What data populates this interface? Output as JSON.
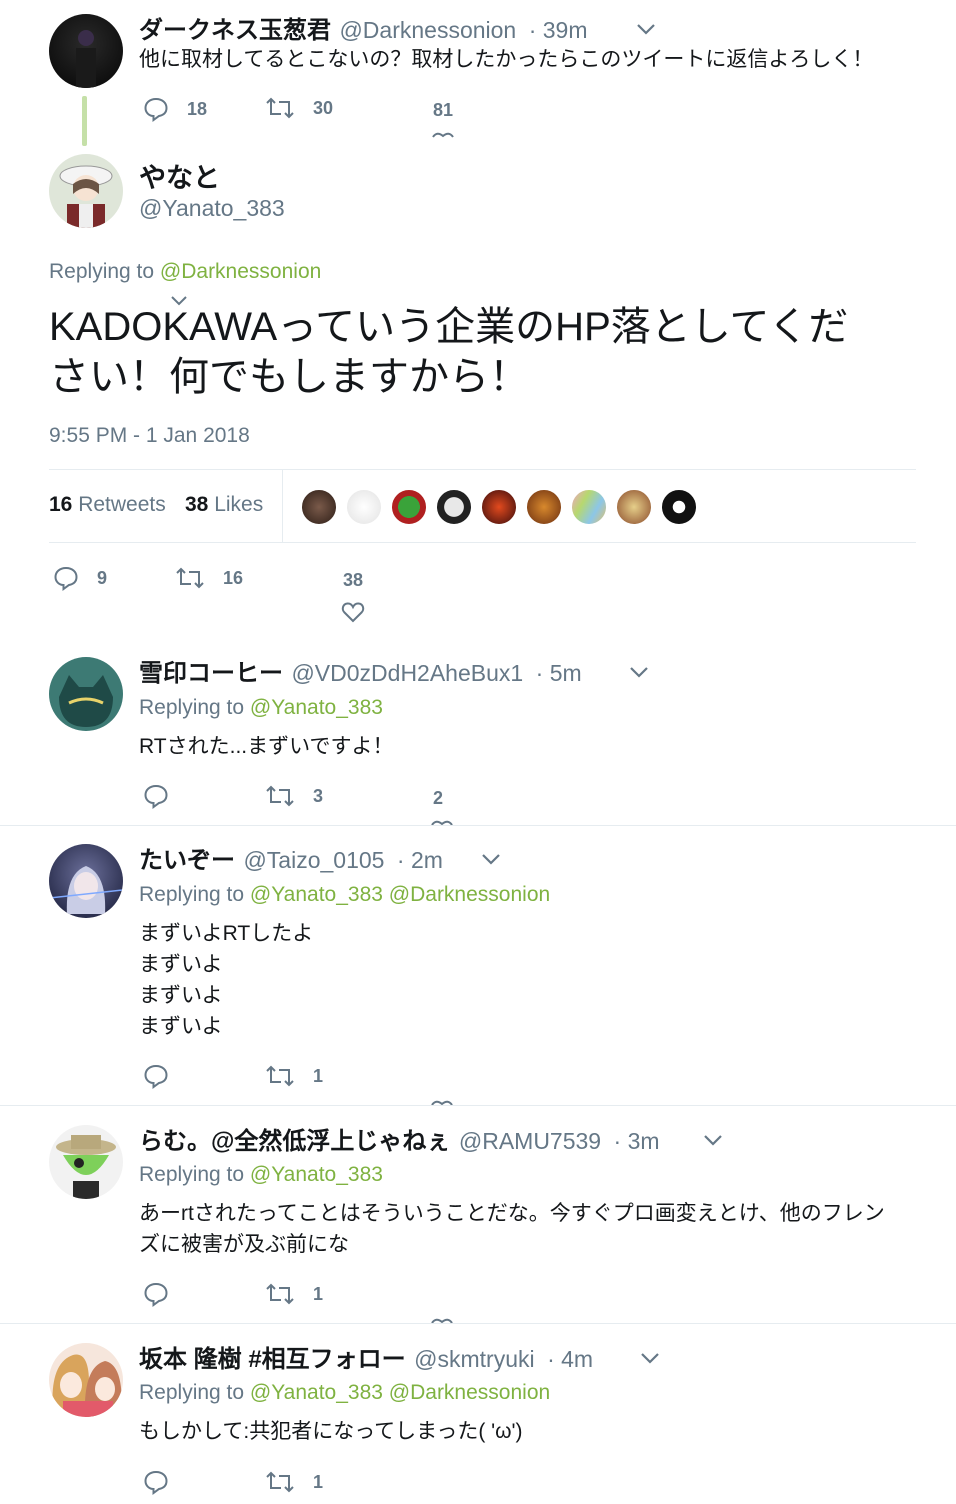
{
  "parent_tweet": {
    "name": "ダークネス玉葱君",
    "handle": "@Darknessonion",
    "time": "· 39m",
    "text": "他に取材してるとこないの？取材したかったらこのツイートに返信よろしく！",
    "replies": "18",
    "retweets": "30",
    "likes": "81"
  },
  "main_tweet": {
    "name": "やなと",
    "handle": "@Yanato_383",
    "replying_prefix": "Replying to",
    "replying_to": "@Darknessonion",
    "text_line1": "KADOKAWAっていう企業のHP落としてくだ",
    "text_line2": "さい！何でもしますから！",
    "timestamp": "9:55 PM - 1 Jan 2018",
    "retweet_count": "16",
    "retweet_label": "Retweets",
    "like_count": "38",
    "like_label": "Likes",
    "replies": "9",
    "retweets": "16",
    "likes": "38"
  },
  "replies": [
    {
      "name": "雪印コーヒー",
      "handle": "@VD0zDdH2AheBux1",
      "time": "· 5m",
      "replying_prefix": "Replying to",
      "replying_to": "@Yanato_383",
      "lines": [
        "RTされた...まずいですよ！"
      ],
      "retweets": "3",
      "likes": "2"
    },
    {
      "name": "たいぞー",
      "handle": "@Taizo_0105",
      "time": "· 2m",
      "replying_prefix": "Replying to",
      "replying_to": "@Yanato_383 @Darknessonion",
      "lines": [
        "まずいよRTしたよ",
        "まずいよ",
        "まずいよ",
        "まずいよ"
      ],
      "retweets": "1"
    },
    {
      "name": "らむ。@全然低浮上じゃねぇ",
      "handle": "@RAMU7539",
      "time": "· 3m",
      "replying_prefix": "Replying to",
      "replying_to": "@Yanato_383",
      "lines": [
        "あーrtされたってことはそういうことだな。今すぐプロ画変えとけ、他のフレン",
        "ズに被害が及ぶ前にな"
      ],
      "retweets": "1"
    },
    {
      "name": "坂本 隆樹 #相互フォロー",
      "handle": "@skmtryuki",
      "time": "· 4m",
      "replying_prefix": "Replying to",
      "replying_to": "@Yanato_383 @Darknessonion",
      "lines": [
        "もしかして:共犯者になってしまった( 'ω')"
      ],
      "retweets": "1"
    }
  ]
}
